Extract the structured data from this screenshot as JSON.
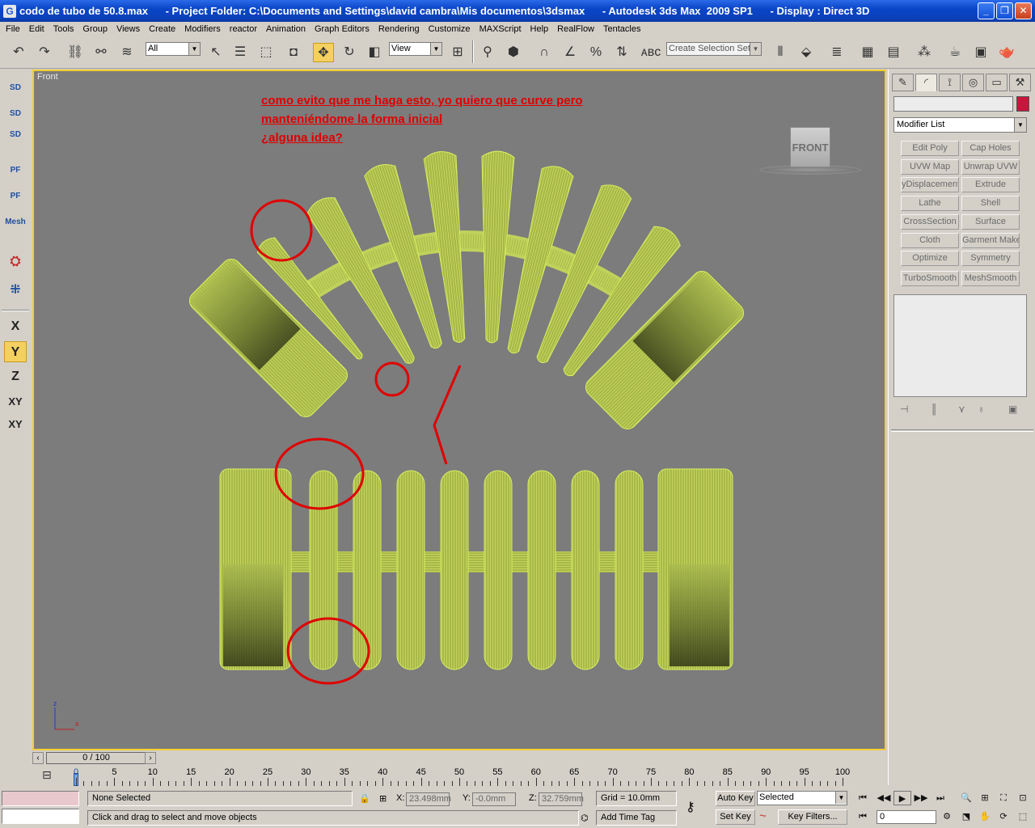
{
  "window": {
    "title": "codo de tubo de 50.8.max      - Project Folder: C:\\Documents and Settings\\david cambra\\Mis documentos\\3dsmax      - Autodesk 3ds Max  2009 SP1      - Display : Direct 3D",
    "controls": [
      "_",
      "❐",
      "✕"
    ]
  },
  "menu": [
    "File",
    "Edit",
    "Tools",
    "Group",
    "Views",
    "Create",
    "Modifiers",
    "reactor",
    "Animation",
    "Graph Editors",
    "Rendering",
    "Customize",
    "MAXScript",
    "Help",
    "RealFlow",
    "Tentacles"
  ],
  "toolbar": {
    "filter_value": "All",
    "refcoord_value": "View",
    "selection_set_placeholder": "Create Selection Set"
  },
  "left_toolbar": {
    "buttons": [
      "SD",
      "SD",
      "SD",
      "PF",
      "PF",
      "Mesh"
    ],
    "axes": [
      "X",
      "Y",
      "Z",
      "XY",
      "XY"
    ],
    "active_axis": "Y"
  },
  "viewport": {
    "label": "Front",
    "annotation": [
      "como evito que me haga esto, yo quiero que curve pero ",
      "manteniéndome la forma inicial",
      "¿alguna idea?"
    ],
    "viewcube_label": "FRONT",
    "tripod": {
      "z": "z",
      "x": "x"
    },
    "wire_color": "#d8f060",
    "annotation_color": "#e00000"
  },
  "command_panel": {
    "modifier_list_label": "Modifier List",
    "modifier_buttons": [
      "Edit Poly",
      "Cap Holes",
      "UVW Map",
      "Unwrap UVW",
      "yDisplacement",
      "Extrude",
      "Lathe",
      "Shell",
      "CrossSection",
      "Surface",
      "Cloth",
      "Garment Make",
      "Optimize",
      "Symmetry",
      "TurboSmooth",
      "MeshSmooth"
    ]
  },
  "time_slider": {
    "position_text": "0 / 100",
    "frame_labels": [
      "0",
      "5",
      "10",
      "15",
      "20",
      "25",
      "30",
      "35",
      "40",
      "45",
      "50",
      "55",
      "60",
      "65",
      "70",
      "75",
      "80",
      "85",
      "90",
      "95",
      "100"
    ]
  },
  "status": {
    "selection_text": "None Selected",
    "prompt_text": "Click and drag to select and move objects",
    "x_label": "X:",
    "x_value": "23.498mm",
    "y_label": "Y:",
    "y_value": "-0.0mm",
    "z_label": "Z:",
    "z_value": "32.759mm",
    "grid_text": "Grid = 10.0mm",
    "add_time_tag": "Add Time Tag",
    "auto_key": "Auto Key",
    "set_key": "Set Key",
    "key_mode_value": "Selected",
    "key_filters": "Key Filters...",
    "frame_value": "0"
  }
}
